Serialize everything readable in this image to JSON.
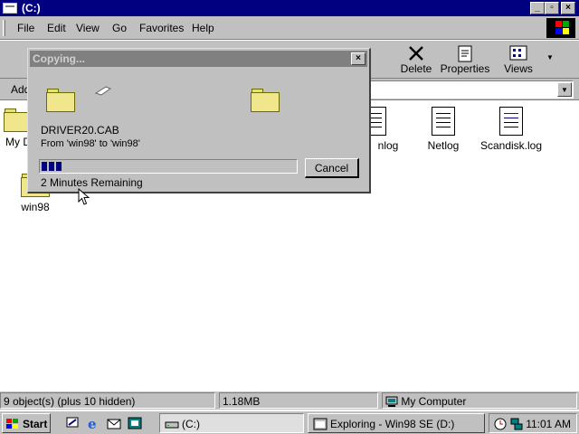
{
  "window": {
    "title": "(C:)"
  },
  "menu": [
    "File",
    "Edit",
    "View",
    "Go",
    "Favorites",
    "Help"
  ],
  "toolbar": {
    "delete_label": "Delete",
    "properties_label": "Properties",
    "views_label": "Views"
  },
  "address": {
    "label": "Add",
    "value": ""
  },
  "files": [
    {
      "label": "My D",
      "icon": "folder-icon"
    },
    {
      "label": "win98",
      "icon": "folder-icon"
    },
    {
      "label": "nlog",
      "icon": "text-file-icon"
    },
    {
      "label": "Netlog",
      "icon": "text-file-icon"
    },
    {
      "label": "Scandisk.log",
      "icon": "log-file-icon"
    }
  ],
  "dialog": {
    "title": "Copying...",
    "filename": "DRIVER20.CAB",
    "from_to": "From 'win98' to 'win98'",
    "remaining": "2 Minutes Remaining",
    "cancel_label": "Cancel",
    "progress_fraction": 0.08
  },
  "status": {
    "objects": "9 object(s) (plus 10 hidden)",
    "size": "1.18MB",
    "location": "My Computer"
  },
  "taskbar": {
    "start_label": "Start",
    "tasks": [
      {
        "label": "(C:)"
      },
      {
        "label": "Exploring - Win98 SE (D:)"
      }
    ],
    "clock": "11:01 AM"
  },
  "colors": {
    "title_active": "#000080",
    "title_inactive": "#808080",
    "face": "#c0c0c0",
    "progress": "#000080"
  }
}
